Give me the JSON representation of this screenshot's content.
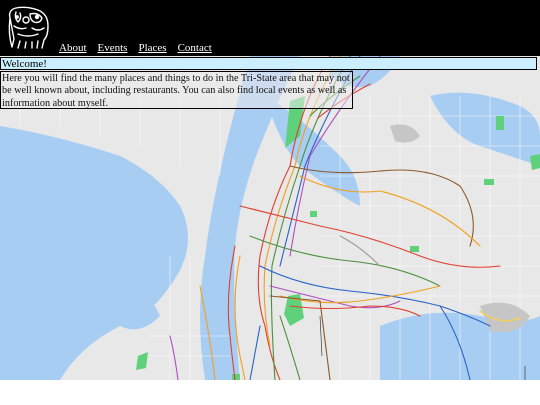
{
  "header": {
    "logo_icon": "creature-logo-icon",
    "background": "#000000"
  },
  "nav": {
    "items": [
      {
        "label": "About"
      },
      {
        "label": "Events"
      },
      {
        "label": "Places"
      },
      {
        "label": "Contact"
      }
    ]
  },
  "welcome": {
    "title": "Welcome!",
    "body": "Here you will find the many places and things to do in the Tri-State area that may not be well known about, including restaurants. You can also find local events as well as information about myself.",
    "bar_color": "#ccefff"
  },
  "map": {
    "icon": "subway-map-background",
    "water_color": "#a8cdf3",
    "land_color": "#e8e8e8",
    "park_color": "#5fd17a"
  }
}
